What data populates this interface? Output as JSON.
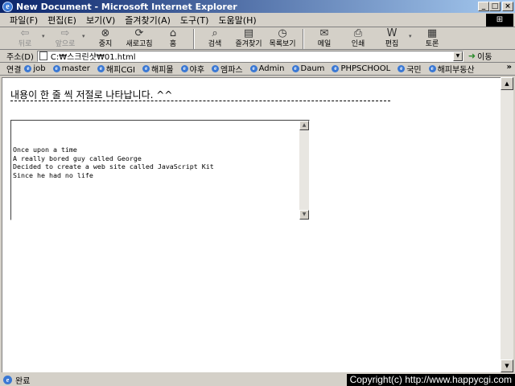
{
  "window": {
    "title": "New Document - Microsoft Internet Explorer",
    "controls": [
      "_",
      "□",
      "×"
    ]
  },
  "menu": [
    "파일(F)",
    "편집(E)",
    "보기(V)",
    "즐겨찾기(A)",
    "도구(T)",
    "도움말(H)"
  ],
  "toolbar": {
    "back": "뒤로",
    "forward": "앞으로",
    "stop": "중지",
    "refresh": "새로고침",
    "home": "홈",
    "search": "검색",
    "favorites": "즐겨찾기",
    "history": "목록보기",
    "mail": "메일",
    "print": "인쇄",
    "edit": "편집",
    "discuss": "토론"
  },
  "address": {
    "label": "주소(D)",
    "value": "C:₩스크린샷₩01.html",
    "go": "이동"
  },
  "links": {
    "label": "연결",
    "items": [
      "job",
      "master",
      "해피CGI",
      "해피몰",
      "야후",
      "엠파스",
      "Admin",
      "Daum",
      "PHPSCHOOL",
      "국민",
      "해피부동산"
    ],
    "more": "»"
  },
  "content": {
    "heading": "내용이 한 줄 씩 저절로 나타납니다. ^^",
    "textarea_lines": "Once upon a time\nA really bored guy called George\nDecided to create a web site called JavaScript Kit\nSince he had no life"
  },
  "status": {
    "text": "완료",
    "copyright": "Copyright(c) http://www.happycgi.com"
  },
  "colors": {
    "titlebar_start": "#0a246a",
    "titlebar_end": "#a6caf0",
    "chrome": "#d4d0c8"
  }
}
